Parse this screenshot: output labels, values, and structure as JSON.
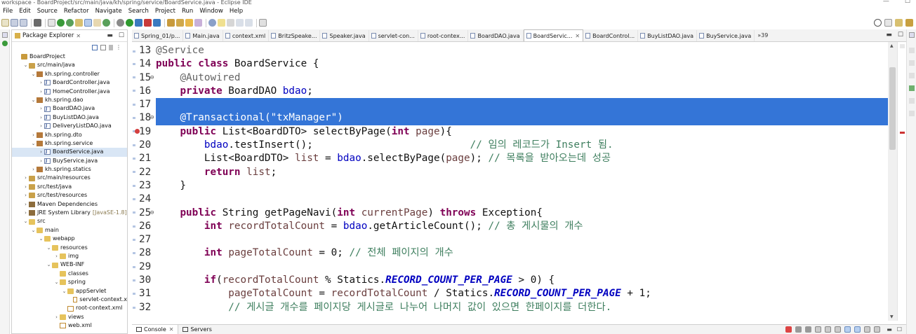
{
  "window": {
    "title": "workspace - BoardProject/src/main/java/kh/spring/service/BoardService.java - Eclipse IDE"
  },
  "menu": [
    "File",
    "Edit",
    "Source",
    "Refactor",
    "Navigate",
    "Search",
    "Project",
    "Run",
    "Window",
    "Help"
  ],
  "package_explorer": {
    "title": "Package Explorer",
    "tree": [
      {
        "depth": 0,
        "twisty": "",
        "icon": "proj",
        "label": "BoardProject"
      },
      {
        "depth": 1,
        "twisty": "v",
        "icon": "src",
        "label": "src/main/java"
      },
      {
        "depth": 2,
        "twisty": "v",
        "icon": "pkg",
        "label": "kh.spring.controller"
      },
      {
        "depth": 3,
        "twisty": ">",
        "icon": "java",
        "label": "BoardController.java"
      },
      {
        "depth": 3,
        "twisty": ">",
        "icon": "java",
        "label": "HomeController.java"
      },
      {
        "depth": 2,
        "twisty": "v",
        "icon": "pkg",
        "label": "kh.spring.dao"
      },
      {
        "depth": 3,
        "twisty": ">",
        "icon": "java",
        "label": "BoardDAO.java"
      },
      {
        "depth": 3,
        "twisty": ">",
        "icon": "java",
        "label": "BuyListDAO.java"
      },
      {
        "depth": 3,
        "twisty": ">",
        "icon": "java",
        "label": "DeliveryListDAO.java"
      },
      {
        "depth": 2,
        "twisty": ">",
        "icon": "pkg",
        "label": "kh.spring.dto"
      },
      {
        "depth": 2,
        "twisty": "v",
        "icon": "pkg",
        "label": "kh.spring.service"
      },
      {
        "depth": 3,
        "twisty": ">",
        "icon": "java",
        "label": "BoardService.java",
        "selected": true
      },
      {
        "depth": 3,
        "twisty": ">",
        "icon": "java",
        "label": "BuyService.java"
      },
      {
        "depth": 2,
        "twisty": ">",
        "icon": "pkg",
        "label": "kh.spring.statics"
      },
      {
        "depth": 1,
        "twisty": ">",
        "icon": "src",
        "label": "src/main/resources"
      },
      {
        "depth": 1,
        "twisty": ">",
        "icon": "src",
        "label": "src/test/java"
      },
      {
        "depth": 1,
        "twisty": ">",
        "icon": "src",
        "label": "src/test/resources"
      },
      {
        "depth": 1,
        "twisty": ">",
        "icon": "lib",
        "label": "Maven Dependencies"
      },
      {
        "depth": 1,
        "twisty": ">",
        "icon": "lib",
        "label": "JRE System Library",
        "extra": "[JavaSE-1.8]"
      },
      {
        "depth": 1,
        "twisty": "v",
        "icon": "folder",
        "label": "src"
      },
      {
        "depth": 2,
        "twisty": "v",
        "icon": "folder",
        "label": "main"
      },
      {
        "depth": 3,
        "twisty": "v",
        "icon": "folder",
        "label": "webapp"
      },
      {
        "depth": 4,
        "twisty": "v",
        "icon": "folder",
        "label": "resources"
      },
      {
        "depth": 5,
        "twisty": ">",
        "icon": "folder",
        "label": "img"
      },
      {
        "depth": 4,
        "twisty": "v",
        "icon": "folder",
        "label": "WEB-INF"
      },
      {
        "depth": 5,
        "twisty": "",
        "icon": "folder",
        "label": "classes"
      },
      {
        "depth": 5,
        "twisty": "v",
        "icon": "folder",
        "label": "spring"
      },
      {
        "depth": 6,
        "twisty": "v",
        "icon": "folder",
        "label": "appServlet"
      },
      {
        "depth": 7,
        "twisty": "",
        "icon": "xml",
        "label": "servlet-context.x"
      },
      {
        "depth": 6,
        "twisty": "",
        "icon": "xml",
        "label": "root-context.xml"
      },
      {
        "depth": 5,
        "twisty": ">",
        "icon": "folder",
        "label": "views"
      },
      {
        "depth": 5,
        "twisty": "",
        "icon": "xml",
        "label": "web.xml"
      }
    ]
  },
  "editor_tabs": [
    {
      "label": "Spring_01/p...",
      "active": false
    },
    {
      "label": "Main.java",
      "active": false
    },
    {
      "label": "context.xml",
      "active": false
    },
    {
      "label": "BritzSpeake...",
      "active": false
    },
    {
      "label": "Speaker.java",
      "active": false
    },
    {
      "label": "servlet-con...",
      "active": false
    },
    {
      "label": "root-contex...",
      "active": false
    },
    {
      "label": "BoardDAO.java",
      "active": false
    },
    {
      "label": "BoardServic...",
      "active": true
    },
    {
      "label": "BoardControl...",
      "active": false
    },
    {
      "label": "BuyListDAO.java",
      "active": false
    },
    {
      "label": "BuyService.java",
      "active": false
    }
  ],
  "editor_tabs_more": "»39",
  "code_lines": [
    {
      "n": "13",
      "fold": false,
      "hl": false,
      "err": false,
      "t": [
        [
          "ann",
          "@Service"
        ]
      ]
    },
    {
      "n": "14",
      "fold": false,
      "hl": false,
      "err": false,
      "t": [
        [
          "kw",
          "public"
        ],
        [
          "",
          " "
        ],
        [
          "kw",
          "class"
        ],
        [
          "",
          " BoardService {"
        ]
      ]
    },
    {
      "n": "15",
      "fold": true,
      "hl": false,
      "err": false,
      "t": [
        [
          "",
          "    "
        ],
        [
          "ann",
          "@Autowired"
        ]
      ]
    },
    {
      "n": "16",
      "fold": false,
      "hl": false,
      "err": false,
      "t": [
        [
          "",
          "    "
        ],
        [
          "kw",
          "private"
        ],
        [
          "",
          " BoardDAO "
        ],
        [
          "fld",
          "bdao"
        ],
        [
          "",
          ";"
        ]
      ]
    },
    {
      "n": "17",
      "fold": false,
      "hl": true,
      "err": false,
      "t": [
        [
          "",
          "    "
        ]
      ]
    },
    {
      "n": "18",
      "fold": true,
      "hl": true,
      "err": false,
      "t": [
        [
          "",
          "    "
        ],
        [
          "ann",
          "@Transactional("
        ],
        [
          "str",
          "\"txManager\""
        ],
        [
          "ann",
          ")"
        ]
      ]
    },
    {
      "n": "19",
      "fold": false,
      "hl": false,
      "err": true,
      "t": [
        [
          "",
          "    "
        ],
        [
          "kw",
          "public"
        ],
        [
          "",
          " List<BoardDTO> selectByPage("
        ],
        [
          "kw",
          "int"
        ],
        [
          "",
          " "
        ],
        [
          "var",
          "page"
        ],
        [
          "",
          "){"
        ]
      ]
    },
    {
      "n": "20",
      "fold": false,
      "hl": false,
      "err": false,
      "t": [
        [
          "",
          "        "
        ],
        [
          "fld",
          "bdao"
        ],
        [
          "",
          ".testInsert();                          "
        ],
        [
          "cm",
          "// 임의 레코드가 Insert 됨."
        ]
      ]
    },
    {
      "n": "21",
      "fold": false,
      "hl": false,
      "err": false,
      "t": [
        [
          "",
          "        List<BoardDTO> "
        ],
        [
          "var",
          "list"
        ],
        [
          "",
          " = "
        ],
        [
          "fld",
          "bdao"
        ],
        [
          "",
          ".selectByPage("
        ],
        [
          "var",
          "page"
        ],
        [
          "",
          "); "
        ],
        [
          "cm",
          "// 목록을 받아오는데 성공"
        ]
      ]
    },
    {
      "n": "22",
      "fold": false,
      "hl": false,
      "err": false,
      "t": [
        [
          "",
          "        "
        ],
        [
          "kw",
          "return"
        ],
        [
          "",
          " "
        ],
        [
          "var",
          "list"
        ],
        [
          "",
          ";"
        ]
      ]
    },
    {
      "n": "23",
      "fold": false,
      "hl": false,
      "err": false,
      "t": [
        [
          "",
          "    }"
        ]
      ]
    },
    {
      "n": "24",
      "fold": false,
      "hl": false,
      "err": false,
      "t": [
        [
          "",
          ""
        ]
      ]
    },
    {
      "n": "25",
      "fold": true,
      "hl": false,
      "err": false,
      "t": [
        [
          "",
          "    "
        ],
        [
          "kw",
          "public"
        ],
        [
          "",
          " String getPageNavi("
        ],
        [
          "kw",
          "int"
        ],
        [
          "",
          " "
        ],
        [
          "var",
          "currentPage"
        ],
        [
          "",
          ") "
        ],
        [
          "kw",
          "throws"
        ],
        [
          "",
          " Exception{"
        ]
      ]
    },
    {
      "n": "26",
      "fold": false,
      "hl": false,
      "err": false,
      "t": [
        [
          "",
          "        "
        ],
        [
          "kw",
          "int"
        ],
        [
          "",
          " "
        ],
        [
          "var",
          "recordTotalCount"
        ],
        [
          "",
          " = "
        ],
        [
          "fld",
          "bdao"
        ],
        [
          "",
          ".getArticleCount(); "
        ],
        [
          "cm",
          "// 총 게시물의 개수"
        ]
      ]
    },
    {
      "n": "27",
      "fold": false,
      "hl": false,
      "err": false,
      "t": [
        [
          "",
          ""
        ]
      ]
    },
    {
      "n": "28",
      "fold": false,
      "hl": false,
      "err": false,
      "t": [
        [
          "",
          "        "
        ],
        [
          "kw",
          "int"
        ],
        [
          "",
          " "
        ],
        [
          "var",
          "pageTotalCount"
        ],
        [
          "",
          " = 0; "
        ],
        [
          "cm",
          "// 전체 페이지의 개수"
        ]
      ]
    },
    {
      "n": "29",
      "fold": false,
      "hl": false,
      "err": false,
      "t": [
        [
          "",
          ""
        ]
      ]
    },
    {
      "n": "30",
      "fold": false,
      "hl": false,
      "err": false,
      "t": [
        [
          "",
          "        "
        ],
        [
          "kw",
          "if"
        ],
        [
          "",
          "("
        ],
        [
          "var",
          "recordTotalCount"
        ],
        [
          "",
          " % Statics."
        ],
        [
          "cst",
          "RECORD_COUNT_PER_PAGE"
        ],
        [
          "",
          " > 0) {"
        ]
      ]
    },
    {
      "n": "31",
      "fold": false,
      "hl": false,
      "err": false,
      "t": [
        [
          "",
          "            "
        ],
        [
          "var",
          "pageTotalCount"
        ],
        [
          "",
          " = "
        ],
        [
          "var",
          "recordTotalCount"
        ],
        [
          "",
          " / Statics."
        ],
        [
          "cst",
          "RECORD_COUNT_PER_PAGE"
        ],
        [
          "",
          " + 1;"
        ]
      ]
    },
    {
      "n": "32",
      "fold": false,
      "hl": false,
      "err": false,
      "t": [
        [
          "",
          "            "
        ],
        [
          "cm",
          "// 게시글 개수를 페이지당 게시글로 나누어 나머지 값이 있으면 한페이지를 더한다."
        ]
      ]
    }
  ],
  "bottom_tabs": [
    {
      "label": "Console",
      "active": true
    },
    {
      "label": "Servers",
      "active": false
    }
  ],
  "colors": {
    "selection": "#3475d7",
    "keyword": "#7f0055",
    "string": "#2a00ff",
    "comment": "#3f7f5f",
    "field": "#0000c0"
  }
}
